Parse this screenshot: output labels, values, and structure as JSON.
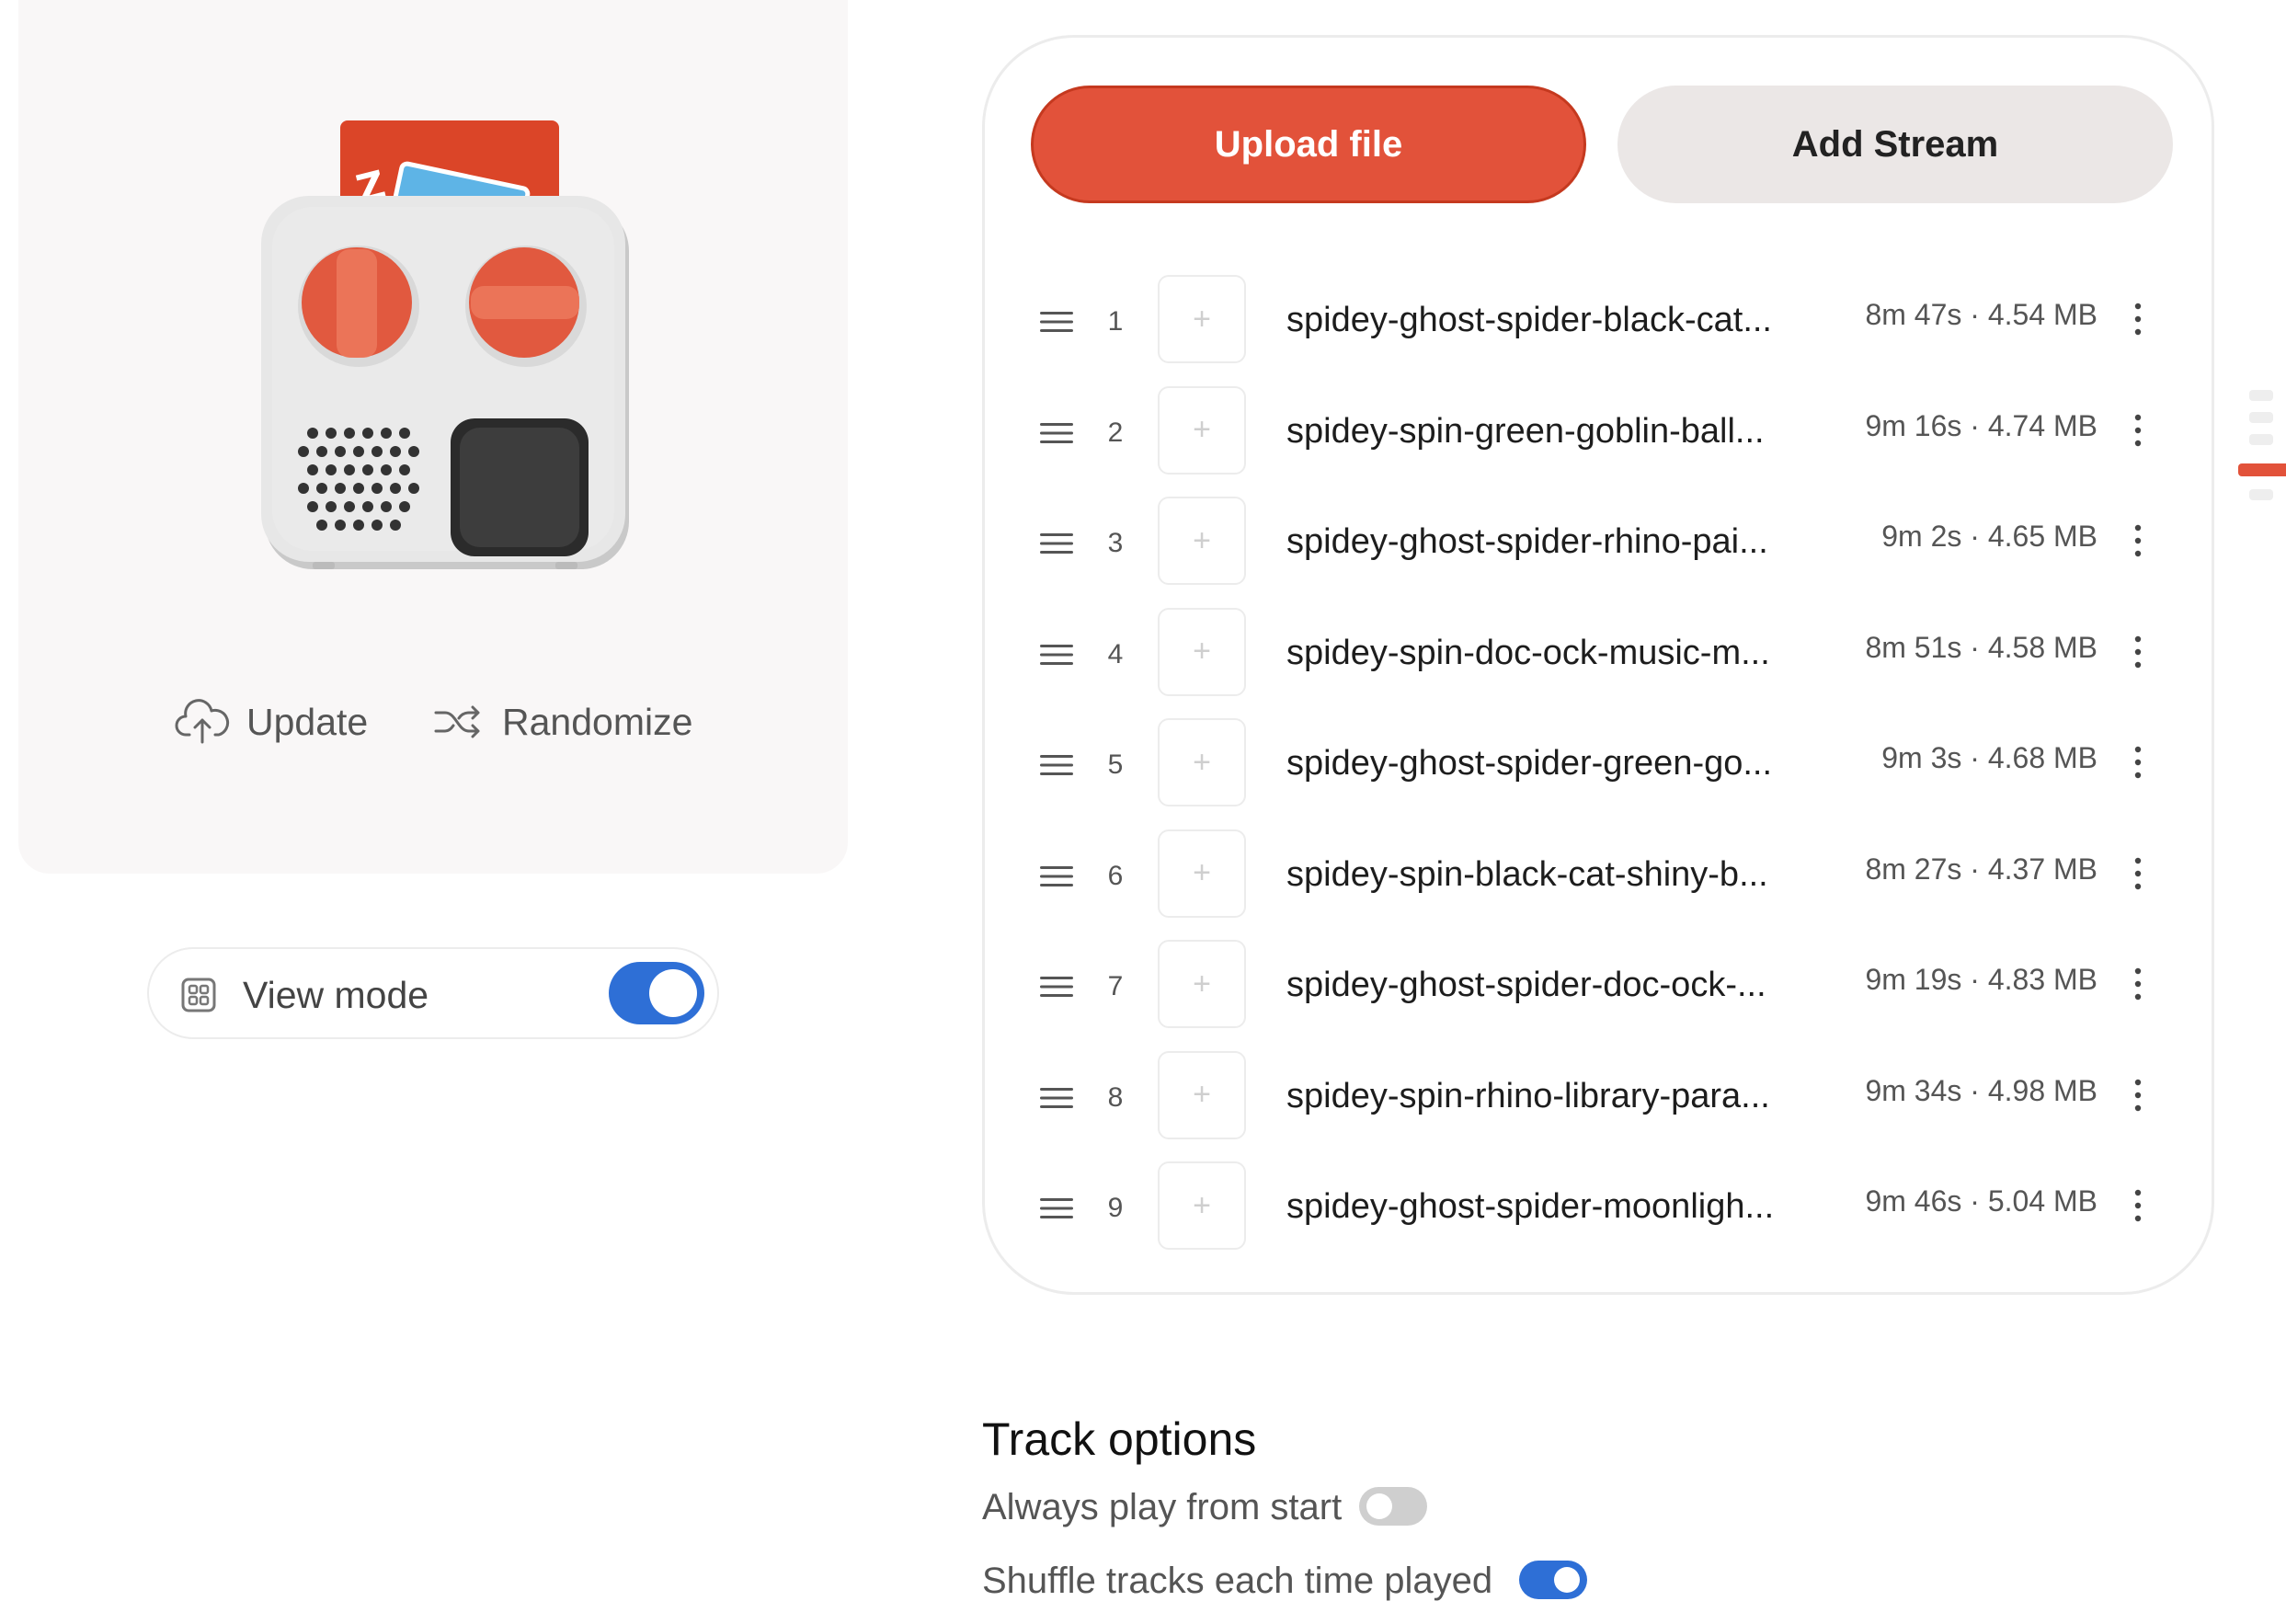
{
  "device_panel": {
    "actions": {
      "update_label": "Update",
      "randomize_label": "Randomize"
    },
    "view_mode": {
      "label": "View mode",
      "enabled": true
    }
  },
  "track_panel": {
    "upload_label": "Upload file",
    "stream_label": "Add Stream",
    "tracks": [
      {
        "number": "1",
        "title": "spidey-ghost-spider-black-cat...",
        "meta": "8m 47s · 4.54 MB"
      },
      {
        "number": "2",
        "title": "spidey-spin-green-goblin-ball...",
        "meta": "9m 16s · 4.74 MB"
      },
      {
        "number": "3",
        "title": "spidey-ghost-spider-rhino-pai...",
        "meta": "9m 2s · 4.65 MB"
      },
      {
        "number": "4",
        "title": "spidey-spin-doc-ock-music-m...",
        "meta": "8m 51s · 4.58 MB"
      },
      {
        "number": "5",
        "title": "spidey-ghost-spider-green-go...",
        "meta": "9m 3s · 4.68 MB"
      },
      {
        "number": "6",
        "title": "spidey-spin-black-cat-shiny-b...",
        "meta": "8m 27s · 4.37 MB"
      },
      {
        "number": "7",
        "title": "spidey-ghost-spider-doc-ock-...",
        "meta": "9m 19s · 4.83 MB"
      },
      {
        "number": "8",
        "title": "spidey-spin-rhino-library-para...",
        "meta": "9m 34s · 4.98 MB"
      },
      {
        "number": "9",
        "title": "spidey-ghost-spider-moonligh...",
        "meta": "9m 46s · 5.04 MB"
      }
    ]
  },
  "track_options": {
    "heading": "Track options",
    "always_play_from_start": {
      "label": "Always play from start",
      "enabled": false
    },
    "shuffle_tracks": {
      "label": "Shuffle tracks each time played",
      "enabled": true
    }
  },
  "colors": {
    "accent": "#e2523a",
    "toggle_on": "#2e6fd6",
    "toggle_off": "#cfcfcf",
    "card_bg": "#f9f7f7"
  },
  "icons": {
    "update": "cloud-upload-icon",
    "randomize": "shuffle-icon",
    "view_mode": "grid-icon",
    "drag": "drag-handle-icon",
    "add": "plus-icon",
    "more": "more-vertical-icon"
  }
}
